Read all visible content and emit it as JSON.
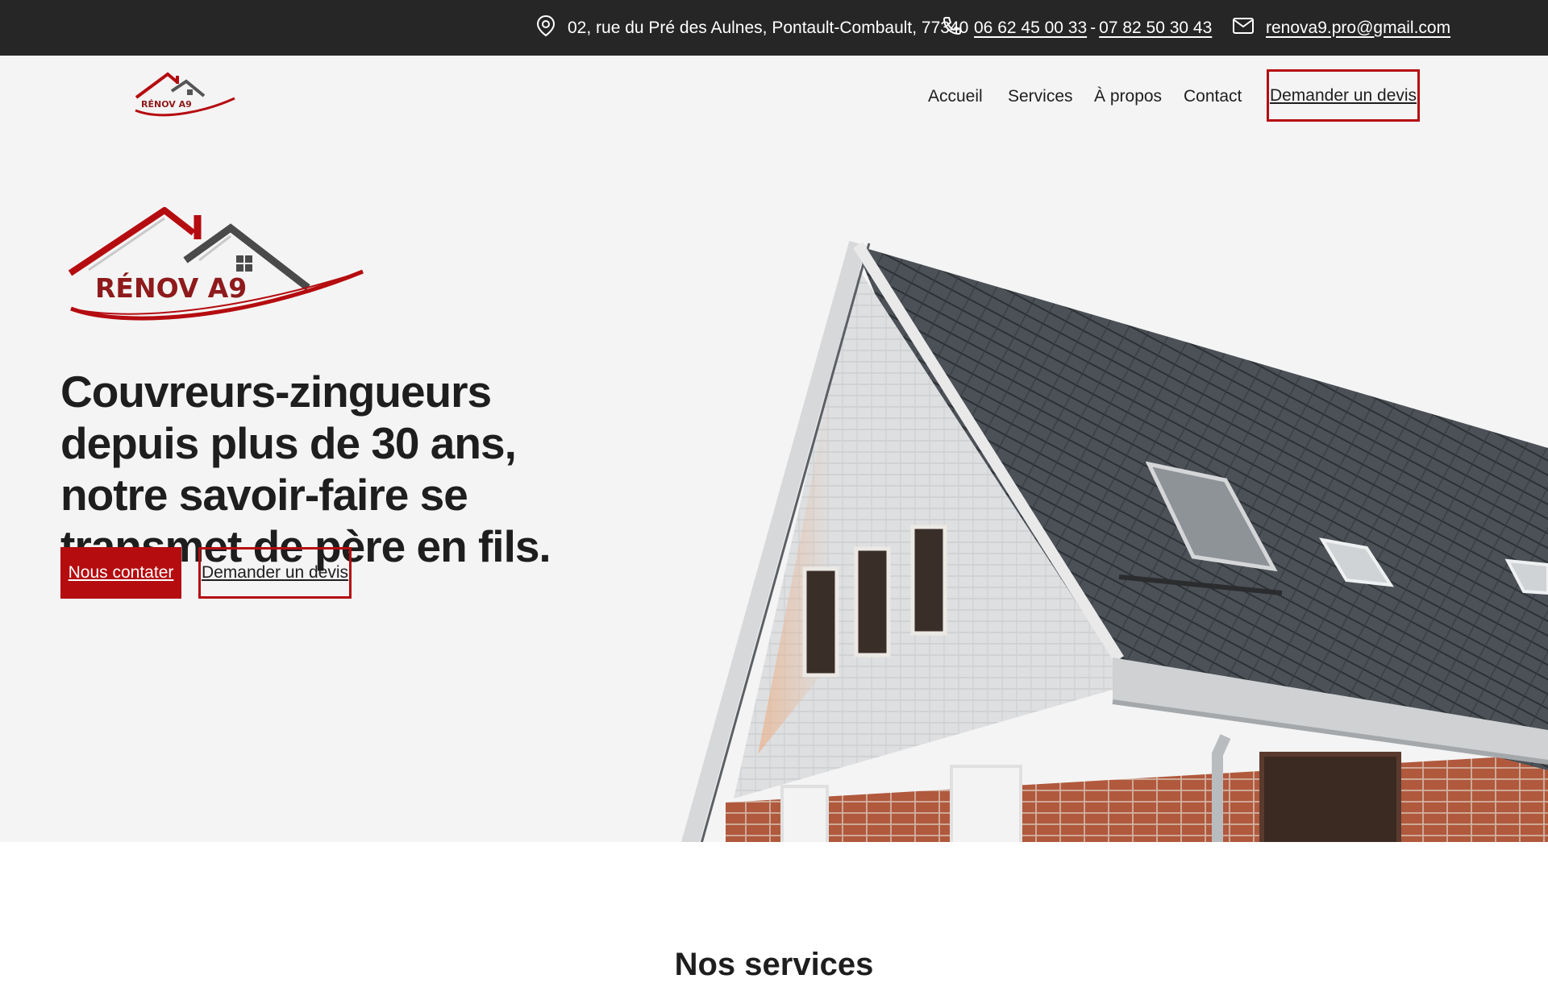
{
  "topbar": {
    "address": "02, rue du Pré des Aulnes, Pontault-Combault, 77340",
    "phone1": "06 62 45 00 33",
    "phone_separator": "-",
    "phone2": "07 82 50 30 43",
    "email": "renova9.pro@gmail.com",
    "icons": {
      "address": "map-pin-icon",
      "phone": "phone-icon",
      "email": "envelope-icon"
    }
  },
  "brand": {
    "logo_text": "RÉNOV A9",
    "colors": {
      "red": "#b50c10",
      "dark": "#262626",
      "roof_gray": "#555555"
    }
  },
  "nav": {
    "items": [
      {
        "label": "Accueil"
      },
      {
        "label": "Services"
      },
      {
        "label": "À propos"
      },
      {
        "label": "Contact"
      }
    ],
    "cta_label": "Demander un devis"
  },
  "hero": {
    "title": "Couvreurs-zingueurs depuis plus de 30 ans, notre savoir-faire se transmet de père en fils.",
    "primary_button": "Nous contater",
    "secondary_button": "Demander un devis"
  },
  "next_section": {
    "title": "Nos services"
  }
}
